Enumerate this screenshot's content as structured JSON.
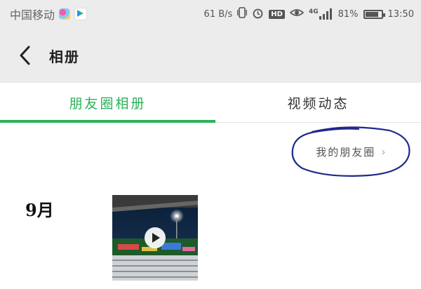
{
  "status_bar": {
    "carrier": "中国移动",
    "speed": "61 B/s",
    "network": "4G",
    "battery_percent": "81%",
    "battery_level": 0.81,
    "time": "13:50",
    "hd_label": "HD"
  },
  "app_bar": {
    "title": "相册",
    "back_icon": "chevron-left-icon"
  },
  "tabs": [
    {
      "label": "朋友圈相册",
      "active": true
    },
    {
      "label": "视频动态",
      "active": false
    }
  ],
  "accent_color": "#2bb15a",
  "moments_link": {
    "label": "我的朋友圈"
  },
  "album": {
    "month_label": "9月",
    "items": [
      {
        "type": "video"
      }
    ]
  }
}
